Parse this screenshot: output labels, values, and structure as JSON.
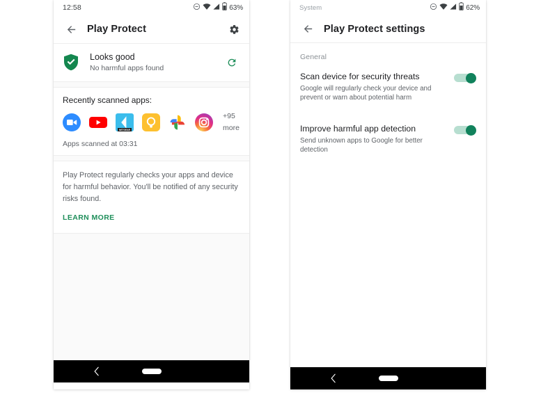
{
  "left_phone": {
    "statusbar": {
      "time": "12:58",
      "battery": "63%",
      "icons": [
        "dnd-icon",
        "wifi-icon",
        "signal-icon",
        "battery-icon"
      ]
    },
    "appbar": {
      "back": "back-arrow-icon",
      "title": "Play Protect",
      "settings": "gear-icon"
    },
    "status_card": {
      "icon": "shield-check-icon",
      "title": "Looks good",
      "subtitle": "No harmful apps found",
      "refresh": "refresh-icon"
    },
    "scanned_card": {
      "heading": "Recently scanned apps:",
      "apps": [
        {
          "name": "zoom-app-icon",
          "label": "Zoom"
        },
        {
          "name": "youtube-app-icon",
          "label": "YouTube"
        },
        {
          "name": "netgear-app-icon",
          "label": "NETGEAR"
        },
        {
          "name": "lightbulb-app-icon",
          "label": "Smart Bulb"
        },
        {
          "name": "google-photos-app-icon",
          "label": "Google Photos"
        },
        {
          "name": "instagram-app-icon",
          "label": "Instagram"
        }
      ],
      "more_count": "+95",
      "more_word": "more",
      "scan_time": "Apps scanned at 03:31"
    },
    "info_card": {
      "text": "Play Protect regularly checks your apps and device for harmful behavior. You'll be notified of any security risks found.",
      "learn_more": "LEARN MORE"
    },
    "navbar": {
      "back": "nav-back-icon",
      "home": "nav-home-pill"
    }
  },
  "right_phone": {
    "statusbar": {
      "label": "System",
      "battery": "62%",
      "icons": [
        "dnd-icon",
        "wifi-icon",
        "signal-icon",
        "battery-icon"
      ]
    },
    "appbar": {
      "back": "back-arrow-icon",
      "title": "Play Protect settings"
    },
    "section_header": "General",
    "settings": [
      {
        "title": "Scan device for security threats",
        "subtitle": "Google will regularly check your device and prevent or warn about potential harm",
        "toggle_state": "on"
      },
      {
        "title": "Improve harmful app detection",
        "subtitle": "Send unknown apps to Google for better detection",
        "toggle_state": "on"
      }
    ],
    "navbar": {
      "back": "nav-back-icon",
      "home": "nav-home-pill"
    }
  },
  "colors": {
    "accent_green": "#1e8e5a",
    "toggle_on": "#11825c",
    "toggle_track": "#b7ded0",
    "text_primary": "#202124",
    "text_secondary": "#5f6368",
    "page_bg": "#fafafa"
  }
}
